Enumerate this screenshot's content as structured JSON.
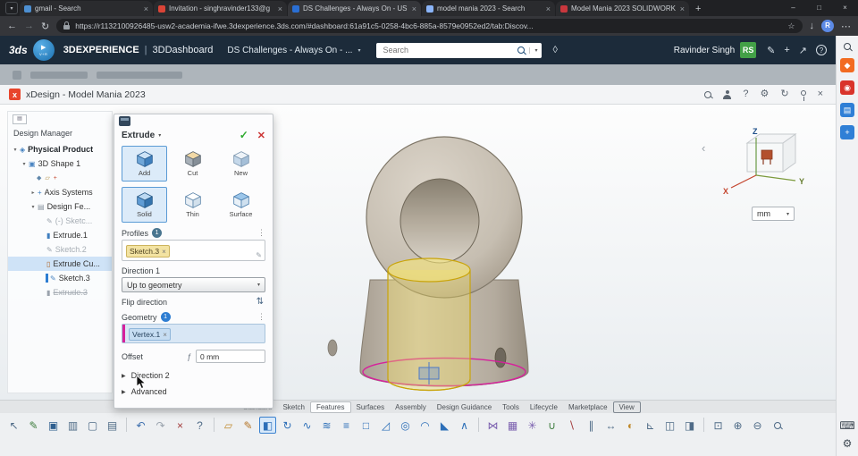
{
  "browser": {
    "tab_search_glyph": "▾",
    "new_tab_glyph": "+",
    "tab_close_glyph": "×",
    "tabs": [
      {
        "label": "gmail - Search",
        "favicon_color": "#4d8fd1",
        "active": false
      },
      {
        "label": "Invitation - singhravinder133@g",
        "favicon_color": "#db4437",
        "active": false
      },
      {
        "label": "DS Challenges - Always On - US",
        "favicon_color": "#2a6fd4",
        "active": true
      },
      {
        "label": "model mania 2023 - Search",
        "favicon_color": "#8ab4f8",
        "active": false
      },
      {
        "label": "Model Mania 2023 SOLIDWORK",
        "favicon_color": "#c8373d",
        "active": false
      }
    ],
    "window_controls": [
      {
        "name": "minimize",
        "glyph": "–"
      },
      {
        "name": "maximize",
        "glyph": "□"
      },
      {
        "name": "close",
        "glyph": "×"
      }
    ],
    "nav": {
      "back": "←",
      "forward": "→",
      "refresh": "↻"
    },
    "url": "https://r1132100926485-usw2-academia-ifwe.3dexperience.3ds.com/#dashboard:61a91c5-0258-4bc6-885a-8579e0952ed2/tab:Discov...",
    "star_glyph": "☆",
    "downloads_glyph": "↓",
    "avatar_initial": "R",
    "menu_glyph": "⋯"
  },
  "platform": {
    "logo_text": "3ds",
    "compass_play": "▶",
    "compass_sub": "V+R",
    "brand": "3DEXPERIENCE",
    "divider": "|",
    "app_name": "3DDashboard",
    "dashboard_title": "DS Challenges - Always On - ...",
    "chevron": "▾",
    "search_placeholder": "Search",
    "search_chevron": "▾",
    "tag_glyph": "◊",
    "user_name": "Ravinder Singh",
    "user_initials": "RS",
    "user_badge_color": "#43a047",
    "right_icons": [
      {
        "name": "ink-annotation-icon",
        "glyph": "✎"
      },
      {
        "name": "add-content-icon",
        "glyph": "+"
      },
      {
        "name": "share-icon",
        "glyph": "↗"
      },
      {
        "name": "help-icon",
        "glyph": "?"
      }
    ]
  },
  "appbar": {
    "icon_text": "x",
    "icon_bg": "#e8452c",
    "title": "xDesign - Model Mania 2023",
    "right_icons": [
      {
        "name": "app-search",
        "type": "mag"
      },
      {
        "name": "share-user",
        "type": "person"
      },
      {
        "name": "app-help",
        "glyph": "?"
      },
      {
        "name": "app-settings",
        "glyph": "⚙"
      },
      {
        "name": "app-refresh",
        "glyph": "↻"
      },
      {
        "name": "app-pin",
        "type": "pin"
      },
      {
        "name": "app-close",
        "glyph": "×"
      }
    ]
  },
  "tree": {
    "panel_title": "Design Manager",
    "view_toggle_glyph": "▤",
    "items": [
      {
        "label": "Physical Product",
        "level": 0,
        "arrow": "down",
        "glyph": "◈",
        "color": "#3f7fbf",
        "bold": true
      },
      {
        "label": "3D Shape 1",
        "level": 1,
        "arrow": "down",
        "glyph": "▣",
        "color": "#4c86c2"
      },
      {
        "label": "",
        "level": 2,
        "icons": [
          {
            "name": "origin",
            "glyph": "◆",
            "color": "#5f87ab"
          },
          {
            "name": "planes",
            "glyph": "▱",
            "color": "#b08a3e"
          },
          {
            "name": "axes",
            "glyph": "+",
            "color": "#c4452e"
          }
        ]
      },
      {
        "label": "Axis Systems",
        "level": 2,
        "arrow": "right",
        "glyph": "+",
        "color": "#3f7fbf"
      },
      {
        "label": "Design Fe...",
        "level": 2,
        "arrow": "down",
        "glyph": "▤",
        "color": "#8a94a0"
      },
      {
        "label": "(-) Sketc...",
        "level": 3,
        "glyph": "✎",
        "color": "#9aa3ad",
        "muted": true
      },
      {
        "label": "Extrude.1",
        "level": 3,
        "glyph": "▮",
        "color": "#3f7fbf"
      },
      {
        "label": "Sketch.2",
        "level": 3,
        "glyph": "✎",
        "color": "#9aa3ad",
        "muted": true
      },
      {
        "label": "Extrude Cu...",
        "level": 3,
        "glyph": "▯",
        "color": "#b06a2e",
        "selected": true
      },
      {
        "label": "Sketch.3",
        "level": 3,
        "glyph": "✎",
        "color": "#4c86c2",
        "marker": true
      },
      {
        "label": "Extrude.3",
        "level": 3,
        "glyph": "▮",
        "color": "#9aa3ad",
        "muted": true,
        "strike": true
      }
    ]
  },
  "dialog": {
    "title": "Extrude",
    "title_chevron": "▾",
    "confirm_glyph": "✓",
    "cancel_glyph": "✕",
    "menu_dots": "⋮",
    "chip_close_glyph": "×",
    "pencil_glyph": "✎",
    "modes": [
      {
        "label": "Add",
        "selected": true
      },
      {
        "label": "Cut",
        "selected": false
      },
      {
        "label": "New",
        "selected": false
      }
    ],
    "types": [
      {
        "label": "Solid",
        "selected": true
      },
      {
        "label": "Thin",
        "selected": false
      },
      {
        "label": "Surface",
        "selected": false
      }
    ],
    "profiles": {
      "label": "Profiles",
      "count": "1",
      "chips": [
        {
          "label": "Sketch.3"
        }
      ]
    },
    "direction1": {
      "label": "Direction 1",
      "value": "Up to geometry",
      "chevron": "▾"
    },
    "flip": {
      "label": "Flip direction",
      "glyph": "⇅"
    },
    "geometry": {
      "label": "Geometry",
      "count": "1",
      "chips": [
        {
          "label": "Vertex.1"
        }
      ]
    },
    "offset": {
      "label": "Offset",
      "formula_glyph": "ƒ",
      "value": "0 mm"
    },
    "direction2": {
      "caret": "▶",
      "label": "Direction 2"
    },
    "advanced": {
      "caret": "▶",
      "label": "Advanced"
    }
  },
  "viewport": {
    "units_value": "mm",
    "units_chevron": "▾",
    "collapse_glyph": "‹",
    "axes": {
      "x": "X",
      "y": "Y",
      "z": "Z"
    },
    "highlight_color": "#c9a40a",
    "sketch_color": "#d6219c"
  },
  "ribbon": {
    "tabs": [
      {
        "label": "Standard",
        "muted": true
      },
      {
        "label": "Sketch"
      },
      {
        "label": "Features",
        "active": true
      },
      {
        "label": "Surfaces"
      },
      {
        "label": "Assembly"
      },
      {
        "label": "Design Guidance"
      },
      {
        "label": "Tools"
      },
      {
        "label": "Lifecycle"
      },
      {
        "label": "Marketplace"
      },
      {
        "label": "View",
        "focused": true
      }
    ]
  },
  "toolbar": {
    "icons": [
      {
        "name": "selection-filter",
        "glyph": "↖",
        "color": "#4f6b87"
      },
      {
        "name": "sketch-mode",
        "glyph": "✎",
        "color": "#3e7d3e"
      },
      {
        "name": "save",
        "glyph": "▣",
        "color": "#2f5f8f"
      },
      {
        "name": "print",
        "glyph": "▥",
        "color": "#4f6b87"
      },
      {
        "name": "copy",
        "glyph": "▢",
        "color": "#4f6b87"
      },
      {
        "name": "paste",
        "glyph": "▤",
        "color": "#4f6b87"
      },
      {
        "sep": true
      },
      {
        "name": "undo",
        "glyph": "↶",
        "color": "#3e6fae"
      },
      {
        "name": "redo",
        "glyph": "↷",
        "color": "#9aa3ad"
      },
      {
        "name": "delete",
        "glyph": "×",
        "color": "#a33c3c"
      },
      {
        "name": "help",
        "glyph": "?",
        "color": "#4f6b87"
      },
      {
        "sep": true
      },
      {
        "name": "reference-plane",
        "glyph": "▱",
        "color": "#c08a2e"
      },
      {
        "name": "new-sketch",
        "glyph": "✎",
        "color": "#b5762a"
      },
      {
        "name": "extrude",
        "glyph": "◧",
        "color": "#2d6fb8",
        "selected": true
      },
      {
        "name": "revolve",
        "glyph": "↻",
        "color": "#2d6fb8"
      },
      {
        "name": "sweep",
        "glyph": "∿",
        "color": "#2d6fb8"
      },
      {
        "name": "loft",
        "glyph": "≋",
        "color": "#2d6fb8"
      },
      {
        "name": "thicken",
        "glyph": "≡",
        "color": "#2d6fb8"
      },
      {
        "name": "shell",
        "glyph": "□",
        "color": "#2d6fb8"
      },
      {
        "name": "draft",
        "glyph": "◿",
        "color": "#2d6fb8"
      },
      {
        "name": "hole",
        "glyph": "◎",
        "color": "#2d6fb8"
      },
      {
        "name": "fillet",
        "glyph": "◠",
        "color": "#2d6fb8"
      },
      {
        "name": "chamfer",
        "glyph": "◣",
        "color": "#2d6fb8"
      },
      {
        "name": "rib",
        "glyph": "∧",
        "color": "#2d6fb8"
      },
      {
        "sep": true
      },
      {
        "name": "mirror",
        "glyph": "⋈",
        "color": "#7a5fae"
      },
      {
        "name": "linear-pattern",
        "glyph": "▦",
        "color": "#7a5fae"
      },
      {
        "name": "circular-pattern",
        "glyph": "✳",
        "color": "#7a5fae"
      },
      {
        "name": "boolean-add",
        "glyph": "∪",
        "color": "#3e7d3e"
      },
      {
        "name": "boolean-remove",
        "glyph": "∖",
        "color": "#a33c3c"
      },
      {
        "name": "split",
        "glyph": "∥",
        "color": "#4f6b87"
      },
      {
        "name": "scale",
        "glyph": "↔",
        "color": "#4f6b87"
      },
      {
        "name": "material",
        "glyph": "◐",
        "color": "#c08a2e"
      },
      {
        "name": "measure",
        "glyph": "⊾",
        "color": "#4f6b87"
      },
      {
        "name": "section-view",
        "glyph": "◫",
        "color": "#4f6b87"
      },
      {
        "name": "display-style",
        "glyph": "◨",
        "color": "#4f6b87"
      },
      {
        "sep": true
      },
      {
        "name": "zoom-fit",
        "glyph": "⊡",
        "color": "#4f6b87"
      },
      {
        "name": "zoom-in",
        "glyph": "⊕",
        "color": "#4f6b87"
      },
      {
        "name": "zoom-out",
        "glyph": "⊖",
        "color": "#4f6b87"
      },
      {
        "name": "command-search",
        "type": "mag",
        "color": "#4f6b87"
      }
    ]
  },
  "dock": {
    "top": [
      {
        "name": "platform-search",
        "type": "mag"
      },
      {
        "name": "app-swym",
        "glyph": "◆",
        "bg": "#f26b21"
      },
      {
        "name": "app-communities",
        "glyph": "◉",
        "bg": "#d9342b"
      },
      {
        "name": "app-drive",
        "glyph": "▤",
        "bg": "#2f7fd6"
      },
      {
        "name": "app-add",
        "glyph": "+",
        "bg": "#2f7fd6"
      }
    ],
    "bottom": [
      {
        "name": "virtual-keyboard",
        "glyph": "⌨"
      },
      {
        "name": "preferences",
        "glyph": "⚙"
      }
    ]
  }
}
